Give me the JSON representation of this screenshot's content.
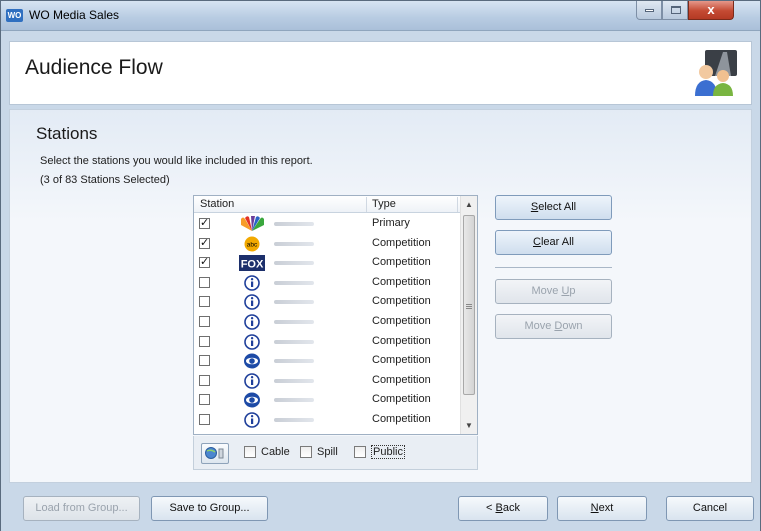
{
  "window": {
    "icon_label": "WO",
    "title": "WO Media Sales",
    "close_glyph": "x"
  },
  "header": {
    "title": "Audience Flow"
  },
  "stations": {
    "section_title": "Stations",
    "instructions": "Select the stations you would like included in this report.",
    "count": "(3 of 83 Stations Selected)",
    "columns": [
      "Station",
      "Type"
    ],
    "rows": [
      {
        "checked": true,
        "logo": "nbc-peacock-logo",
        "type": "Primary"
      },
      {
        "checked": true,
        "logo": "abc-logo",
        "type": "Competition"
      },
      {
        "checked": true,
        "logo": "fox-logo",
        "type": "Competition"
      },
      {
        "checked": false,
        "logo": "info-i-logo",
        "type": "Competition"
      },
      {
        "checked": false,
        "logo": "info-i-logo",
        "type": "Competition"
      },
      {
        "checked": false,
        "logo": "info-i-logo",
        "type": "Competition"
      },
      {
        "checked": false,
        "logo": "info-i-logo",
        "type": "Competition"
      },
      {
        "checked": false,
        "logo": "cbs-eye-logo",
        "type": "Competition"
      },
      {
        "checked": false,
        "logo": "info-i-logo",
        "type": "Competition"
      },
      {
        "checked": false,
        "logo": "cbs-eye-logo",
        "type": "Competition"
      },
      {
        "checked": false,
        "logo": "info-i-logo",
        "type": "Competition"
      }
    ],
    "abc_text": "abc",
    "fox_text": "FOX"
  },
  "filters": {
    "cable": "Cable",
    "spill": "Spill",
    "public": "Public"
  },
  "side_buttons": {
    "select_all_pre": "",
    "select_all_u": "S",
    "select_all_post": "elect All",
    "clear_all_pre": "",
    "clear_all_u": "C",
    "clear_all_post": "lear All",
    "move_up_pre": "Move ",
    "move_up_u": "U",
    "move_up_post": "p",
    "move_down_pre": "Move ",
    "move_down_u": "D",
    "move_down_post": "own"
  },
  "footer": {
    "load_from_group": "Load from Group...",
    "save_to_group": "Save to Group...",
    "back_pre": "< ",
    "back_u": "B",
    "back_post": "ack",
    "next_u": "N",
    "next_post": "ext",
    "cancel": "Cancel"
  },
  "colors": {
    "accent": "#2f6fc0",
    "close": "#c44a33"
  }
}
